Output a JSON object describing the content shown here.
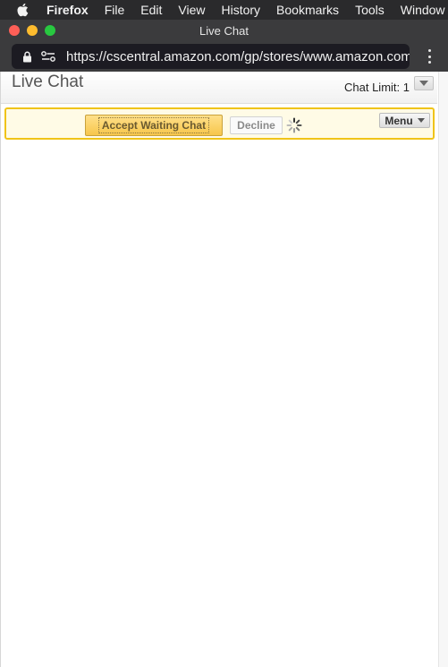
{
  "menubar": {
    "apple_icon": "apple-logo-icon",
    "items": [
      "Firefox",
      "File",
      "Edit",
      "View",
      "History",
      "Bookmarks",
      "Tools",
      "Window"
    ]
  },
  "window": {
    "title": "Live Chat",
    "traffic_colors": {
      "close": "#fe5f57",
      "minimize": "#febc2e",
      "maximize": "#28c840"
    }
  },
  "urlbar": {
    "url": "https://cscentral.amazon.com/gp/stores/www.amazon.com/gp",
    "lock_icon": "lock-icon",
    "permissions_icon": "permissions-icon",
    "menu_icon": "kebab-menu-icon"
  },
  "live_chat": {
    "title": "Live Chat",
    "chat_limit_label": "Chat Limit: 1",
    "notice": {
      "accept_label": "Accept Waiting Chat",
      "decline_label": "Decline",
      "menu_label": "Menu",
      "spinner_icon": "loading-spinner-icon",
      "border_color": "#f0c419",
      "accept_color": "#f7c64b"
    }
  }
}
